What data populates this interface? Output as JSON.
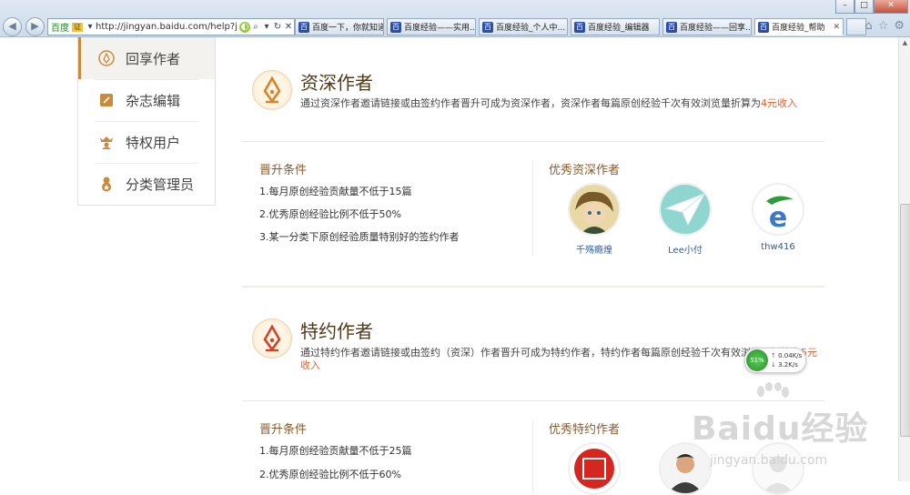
{
  "browser": {
    "search_engine": "百度",
    "security_badge": "证",
    "url": "http://jingyan.baidu.com/help?j",
    "tabs": [
      {
        "label": "百度一下，你就知道"
      },
      {
        "label": "百度经验——实用..."
      },
      {
        "label": "百度经验_个人中..."
      },
      {
        "label": "百度经验_编辑器"
      },
      {
        "label": "百度经验——回享..."
      },
      {
        "label": "百度经验_帮助"
      }
    ],
    "icons": [
      "back-icon",
      "forward-icon",
      "search-icon",
      "refresh-icon",
      "stop-icon",
      "home-icon",
      "star-icon",
      "gear-icon"
    ]
  },
  "sidebar": {
    "items": [
      {
        "label": "回享作者",
        "icon": "pen-nib-icon",
        "active": true
      },
      {
        "label": "杂志编辑",
        "icon": "edit-icon"
      },
      {
        "label": "特权用户",
        "icon": "crown-user-icon"
      },
      {
        "label": "分类管理员",
        "icon": "admin-icon"
      }
    ]
  },
  "sections": [
    {
      "title": "资深作者",
      "desc": "通过资深作者邀请链接或由签约作者晋升可成为资深作者，资深作者每篇原创经验千次有效浏览量折算为",
      "highlight": "4元收入",
      "conditions_title": "晋升条件",
      "conditions": [
        "1.每月原创经验贡献量不低于15篇",
        "2.优秀原创经验比例不低于50%",
        "3.某一分类下原创经验质量特别好的签约作者"
      ],
      "authors_title": "优秀资深作者",
      "authors": [
        {
          "name": "千殇瘾煌"
        },
        {
          "name": "Lee小付"
        },
        {
          "name": "thw416"
        }
      ]
    },
    {
      "title": "特约作者",
      "desc": "通过特约作者邀请链接或由签约（资深）作者晋升可成为特约作者，特约作者每篇原创经验千次有效浏览量折算为",
      "highlight": "5元收入",
      "conditions_title": "晋升条件",
      "conditions": [
        "1.每月原创经验贡献量不低于25篇",
        "2.优秀原创经验比例不低于60%"
      ],
      "authors_title": "优秀特约作者"
    }
  ],
  "net_widget": {
    "percent": "51%",
    "up": "0.04K/s",
    "down": "3.2K/s"
  },
  "watermark": {
    "logo": "Baidu经验",
    "url": "jingyan.baidu.com"
  },
  "colors": {
    "accent": "#c98a3e",
    "highlight": "#e1602a",
    "title": "#523918"
  }
}
